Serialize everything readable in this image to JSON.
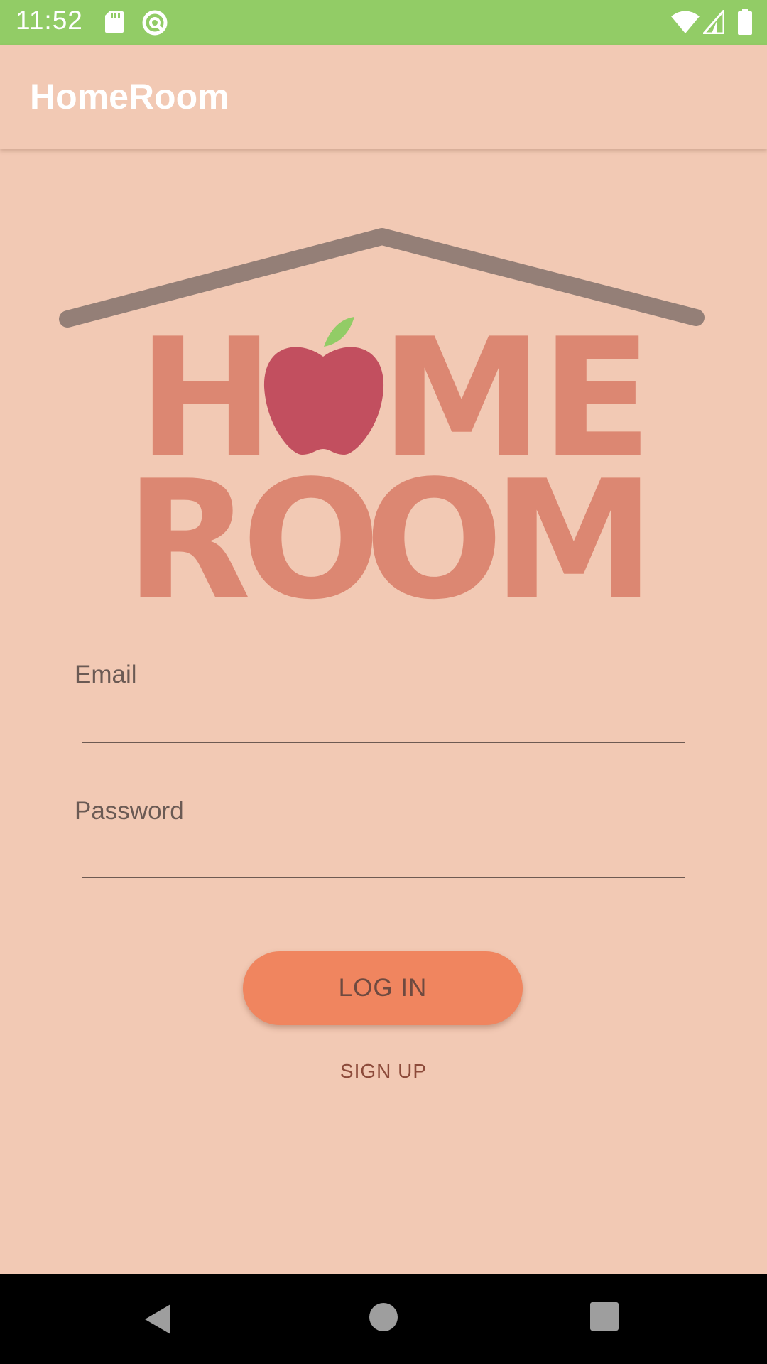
{
  "status_bar": {
    "time": "11:52",
    "icons": [
      "sd-card-icon",
      "sync-icon",
      "wifi-icon",
      "cell-signal-icon",
      "battery-icon"
    ],
    "background": "#92cc66"
  },
  "app_bar": {
    "title": "HomeRoom",
    "background": "#f2c9b4"
  },
  "logo": {
    "line1": "HOME",
    "line2": "ROOM",
    "letter_color": "#dc8772",
    "apple_color": "#c24f5f",
    "leaf_color": "#92cc66",
    "roof_color": "#947f77"
  },
  "form": {
    "email_label": "Email",
    "email_value": "",
    "password_label": "Password",
    "password_value": ""
  },
  "actions": {
    "login_label": "LOG IN",
    "signup_label": "SIGN UP",
    "login_color": "#f0855f"
  },
  "nav_bar": {
    "buttons": [
      "back-icon",
      "home-icon",
      "recents-icon"
    ]
  }
}
